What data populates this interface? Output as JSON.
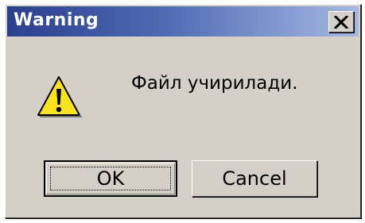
{
  "dialog": {
    "title": "Warning",
    "message": "Файл учирилади.",
    "icon": "warning-icon",
    "buttons": {
      "ok_label": "OK",
      "cancel_label": "Cancel"
    },
    "close_icon": "close-icon",
    "colors": {
      "titlebar_start": "#2b3f8e",
      "titlebar_end": "#a6b8e3",
      "face": "#d4d0c8",
      "warning_yellow": "#f8e41c"
    }
  }
}
